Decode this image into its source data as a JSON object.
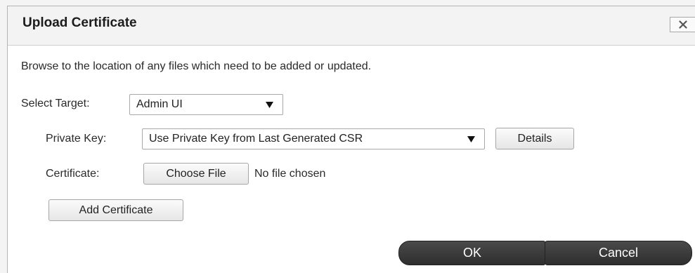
{
  "dialog": {
    "title": "Upload Certificate",
    "close_icon": "close-icon",
    "intro": "Browse to the location of any files which need to be added or updated."
  },
  "form": {
    "target_label": "Select Target:",
    "target_value": "Admin UI",
    "private_key_label": "Private Key:",
    "private_key_value": "Use Private Key from Last Generated CSR",
    "details_label": "Details",
    "certificate_label": "Certificate:",
    "choose_file_label": "Choose File",
    "file_status": "No file chosen",
    "add_certificate_label": "Add Certificate",
    "dropdown_icon": "triangle-down-icon"
  },
  "footer": {
    "ok_label": "OK",
    "cancel_label": "Cancel"
  },
  "colors": {
    "footer_button_bg": "#3a3a3a",
    "title_bar_bg": "#f3f3f3"
  }
}
